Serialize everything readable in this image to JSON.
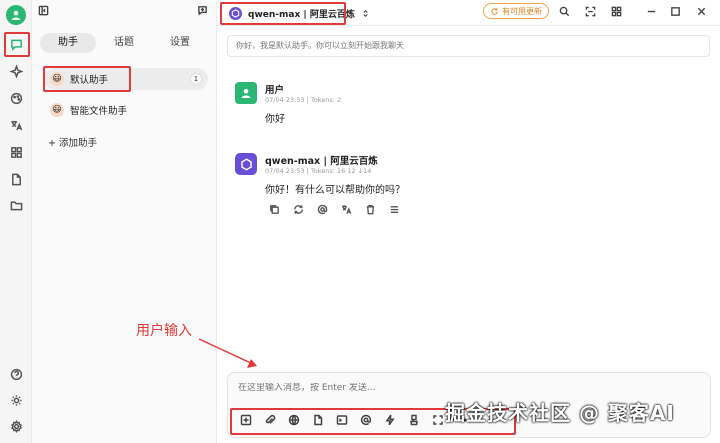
{
  "sidebar_tabs": [
    {
      "label": "助手"
    },
    {
      "label": "话题"
    },
    {
      "label": "设置"
    }
  ],
  "assistants": [
    {
      "name": "默认助手",
      "emoji": "😃",
      "count": "1"
    },
    {
      "name": "智能文件助手",
      "emoji": "😃"
    }
  ],
  "add_assistant": "+ 添加助手",
  "topbar": {
    "model": "qwen-max | 阿里云百炼",
    "update_label": "有可用更新"
  },
  "system_prompt": "你好，我是默认助手。你可以立刻开始跟我聊天",
  "messages": [
    {
      "name": "用户",
      "meta": "07/04 23:53  |  Tokens: 2",
      "text": "你好"
    },
    {
      "name": "qwen-max | 阿里云百炼",
      "meta": "07/04 23:53  |  Tokens: 16 12 ↓14",
      "text": "你好！有什么可以帮助你的吗？"
    }
  ],
  "annotation": "用户输入",
  "input": {
    "placeholder": "在这里输入消息，按 Enter 发送..."
  },
  "watermark": "掘金技术社区 @ 聚客AI",
  "colors": {
    "accent": "#2bb673",
    "highlight": "#e03b3b",
    "model_logo": "#6a4fd6",
    "update": "#f0a64a"
  }
}
